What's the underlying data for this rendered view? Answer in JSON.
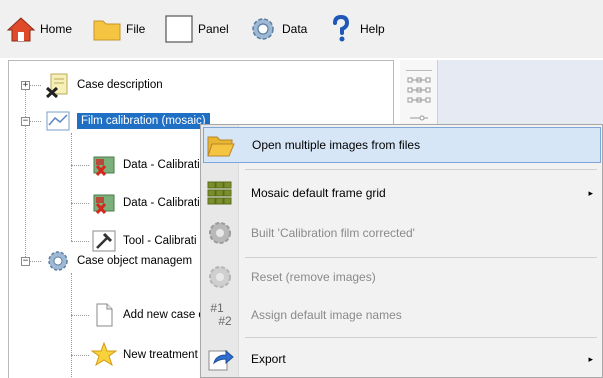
{
  "toolbar": {
    "home": "Home",
    "file": "File",
    "panel": "Panel",
    "data": "Data",
    "help": "Help"
  },
  "tree": {
    "case_description": "Case description",
    "film_calibration": "Film calibration (mosaic)",
    "data_calibration_1": "Data - Calibrati",
    "data_calibration_2": "Data - Calibrati",
    "tool_calibration": "Tool - Calibrati",
    "case_object_management": "Case object managem",
    "add_new_case": "Add new case c",
    "new_treatment": "New treatment"
  },
  "context_menu": {
    "items": [
      {
        "label": "Open multiple images from files",
        "icon": "folder-open-icon",
        "enabled": true,
        "submenu": false
      },
      {
        "label": "Mosaic default frame grid",
        "icon": "grid-icon",
        "enabled": true,
        "submenu": true
      },
      {
        "label": "Built 'Calibration film corrected'",
        "icon": "gear-icon",
        "enabled": false,
        "submenu": false
      },
      {
        "label": "Reset (remove images)",
        "icon": "gear-icon",
        "enabled": false,
        "submenu": false
      },
      {
        "label": "Assign default image names",
        "icon": "numbering-icon",
        "enabled": false,
        "submenu": false
      },
      {
        "label": "Export",
        "icon": "export-icon",
        "enabled": true,
        "submenu": true
      }
    ],
    "numbering_glyph_top": "#1",
    "numbering_glyph_bottom": "#2",
    "submenu_arrow": "▸"
  },
  "tree_expanders": {
    "collapsed": "+",
    "expanded": "−"
  },
  "colors": {
    "selection": "#1f6fc4",
    "menu_hover": "#d7e6f7",
    "folder": "#f5c542"
  }
}
